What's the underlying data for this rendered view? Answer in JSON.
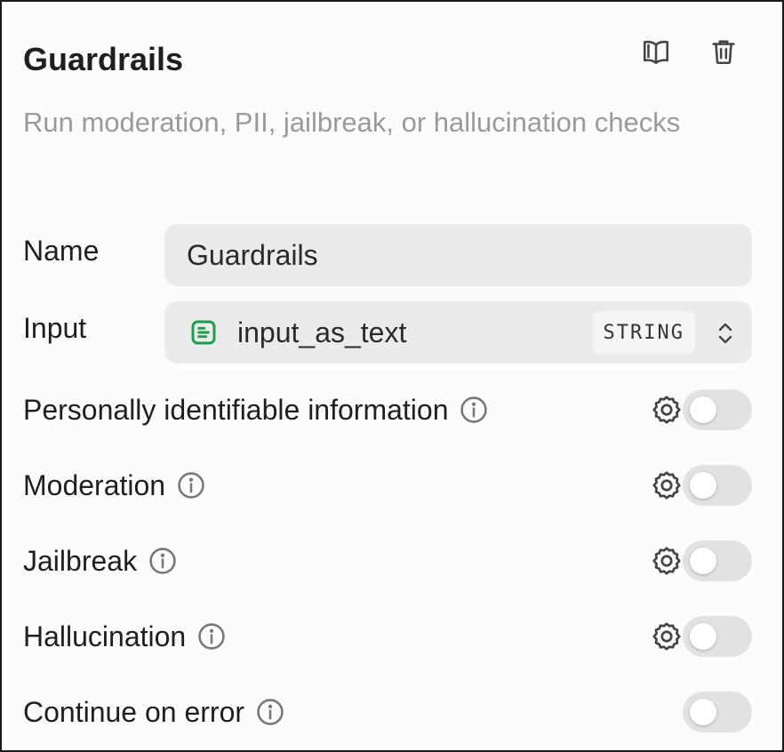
{
  "header": {
    "title": "Guardrails",
    "subtitle": "Run moderation, PII, jailbreak, or hallucination checks"
  },
  "fields": {
    "name": {
      "label": "Name",
      "value": "Guardrails"
    },
    "input": {
      "label": "Input",
      "value": "input_as_text",
      "type": "STRING"
    }
  },
  "checks": [
    {
      "label": "Personally identifiable information",
      "enabled": false,
      "has_settings": true
    },
    {
      "label": "Moderation",
      "enabled": false,
      "has_settings": true
    },
    {
      "label": "Jailbreak",
      "enabled": false,
      "has_settings": true
    },
    {
      "label": "Hallucination",
      "enabled": false,
      "has_settings": true
    }
  ],
  "continue_on_error": {
    "label": "Continue on error",
    "enabled": false
  },
  "colors": {
    "accent_green": "#1a9e4b",
    "muted_text": "#9a9a9a",
    "field_bg": "#ebebeb",
    "toggle_off": "#e2e2e2"
  },
  "icons": [
    "book-icon",
    "trash-icon",
    "text-block-icon",
    "chevron-up-down-icon",
    "info-icon",
    "gear-icon"
  ]
}
